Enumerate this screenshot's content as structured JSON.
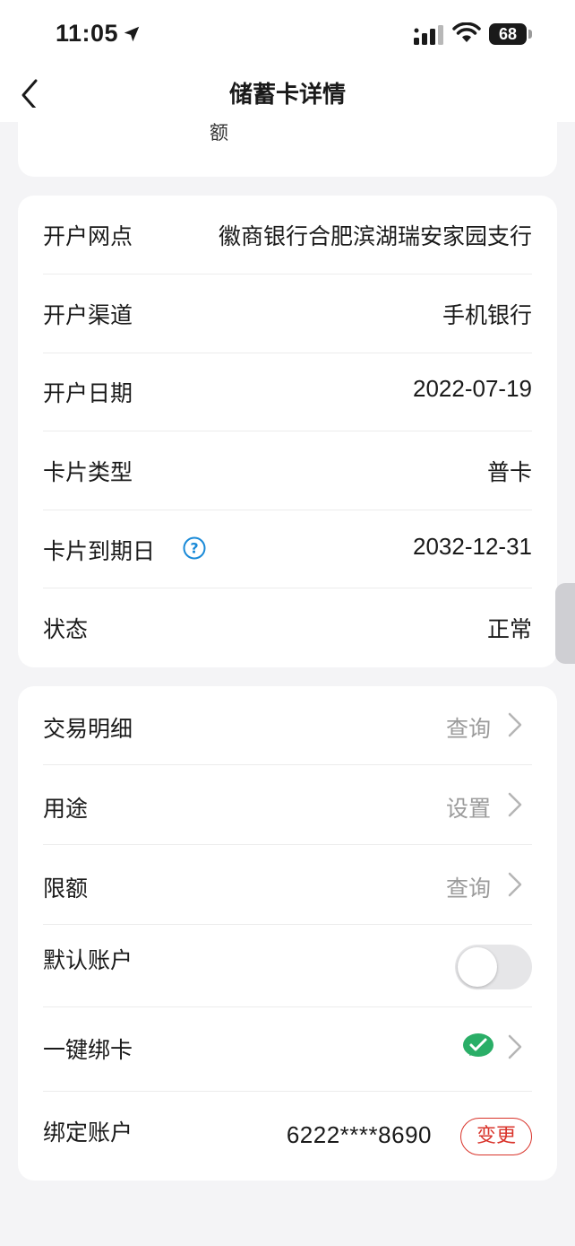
{
  "status_bar": {
    "time": "11:05",
    "battery": "68",
    "icons": [
      "location-arrow-icon",
      "cellular-signal-icon",
      "wifi-icon",
      "battery-icon"
    ]
  },
  "nav": {
    "title": "储蓄卡详情",
    "back_icon": "chevron-left-icon"
  },
  "top_card": {
    "partial_text": "额"
  },
  "info": {
    "rows": [
      {
        "label": "开户网点",
        "value": "徽商银行合肥滨湖瑞安家园支行"
      },
      {
        "label": "开户渠道",
        "value": "手机银行"
      },
      {
        "label": "开户日期",
        "value": "2022-07-19"
      },
      {
        "label": "卡片类型",
        "value": "普卡"
      },
      {
        "label": "卡片到期日",
        "value": "2032-12-31",
        "help_icon": "question-circle-icon"
      },
      {
        "label": "状态",
        "value": "正常"
      }
    ]
  },
  "actions": {
    "transaction_detail": {
      "label": "交易明细",
      "value": "查询"
    },
    "usage": {
      "label": "用途",
      "value": "设置"
    },
    "limit": {
      "label": "限额",
      "value": "查询"
    },
    "default_account": {
      "label": "默认账户",
      "enabled": false
    },
    "one_click_bind": {
      "label": "一键绑卡",
      "icon": "wechat-pay-icon"
    },
    "bound_account": {
      "label": "绑定账户",
      "value": "6222****8690",
      "button": "变更"
    }
  },
  "colors": {
    "accent_red": "#d9342b",
    "help_blue": "#1a8ad8",
    "wechat_green": "#2aae67",
    "muted_text": "#9b9b9b"
  }
}
